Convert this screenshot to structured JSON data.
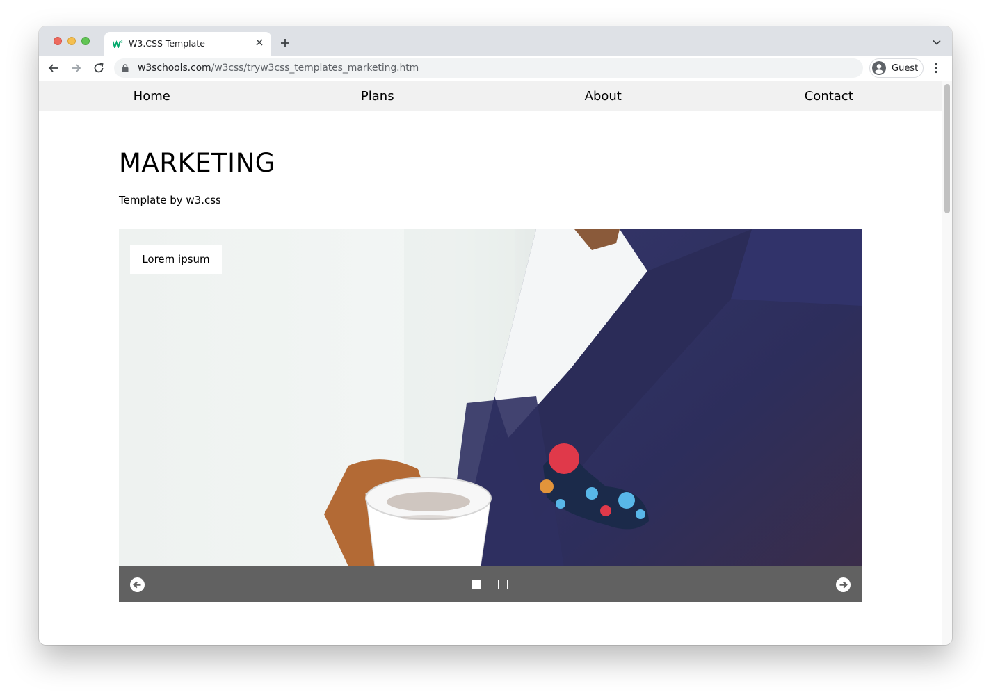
{
  "browser": {
    "tab_title": "W3.CSS Template",
    "url_host": "w3schools.com",
    "url_path": "/w3css/tryw3css_templates_marketing.htm",
    "profile_label": "Guest",
    "favicon_text": "w3"
  },
  "nav": {
    "items": [
      {
        "label": "Home"
      },
      {
        "label": "Plans"
      },
      {
        "label": "About"
      },
      {
        "label": "Contact"
      }
    ]
  },
  "header": {
    "title": "MARKETING",
    "subtitle": "Template by w3.css"
  },
  "slideshow": {
    "caption": "Lorem ipsum",
    "slide_count": 3,
    "active_index": 0,
    "image_description_icon": "coffee-suit-photo"
  },
  "colors": {
    "navbar_bg": "#f1f1f1",
    "controls_bg": "#616161",
    "tabstrip_bg": "#dee1e6",
    "jacket_navy": "#2e2f5e"
  }
}
